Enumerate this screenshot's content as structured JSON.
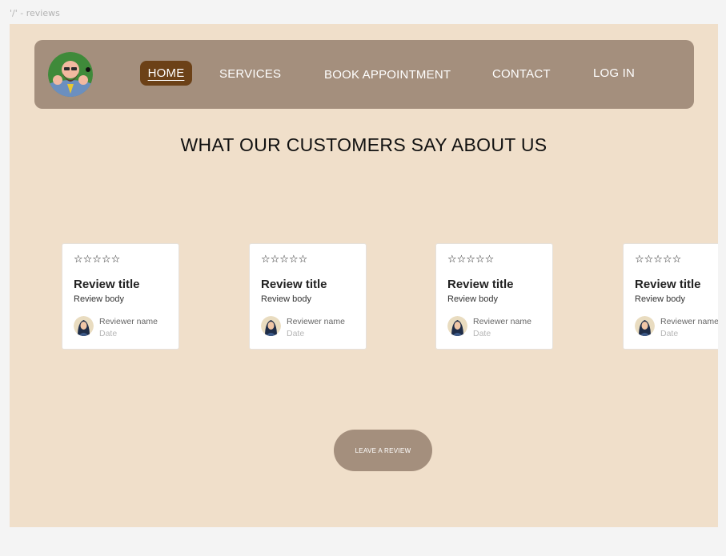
{
  "frame_label": "'/' - reviews",
  "nav": {
    "home": "HOME",
    "services": "SERVICES",
    "book": "BOOK APPOINTMENT",
    "contact": "CONTACT",
    "login": "LOG IN"
  },
  "heading": "WHAT OUR CUSTOMERS SAY ABOUT US",
  "reviews": [
    {
      "stars": "☆☆☆☆☆",
      "title": "Review title",
      "body": "Review body",
      "name": "Reviewer name",
      "date": "Date"
    },
    {
      "stars": "☆☆☆☆☆",
      "title": "Review title",
      "body": "Review body",
      "name": "Reviewer name",
      "date": "Date"
    },
    {
      "stars": "☆☆☆☆☆",
      "title": "Review title",
      "body": "Review body",
      "name": "Reviewer name",
      "date": "Date"
    },
    {
      "stars": "☆☆☆☆☆",
      "title": "Review title",
      "body": "Review body",
      "name": "Reviewer name",
      "date": "Date"
    }
  ],
  "leave_review": "LEAVE A REVIEW",
  "colors": {
    "frame_bg": "#f0dfca",
    "navbar_bg": "#a48f7d",
    "active_nav_bg": "#6c4117",
    "button_bg": "#a48f7d"
  },
  "icons": {
    "logo": "barber-logo-icon",
    "star": "star-outline-icon",
    "avatar": "reviewer-avatar-icon"
  }
}
